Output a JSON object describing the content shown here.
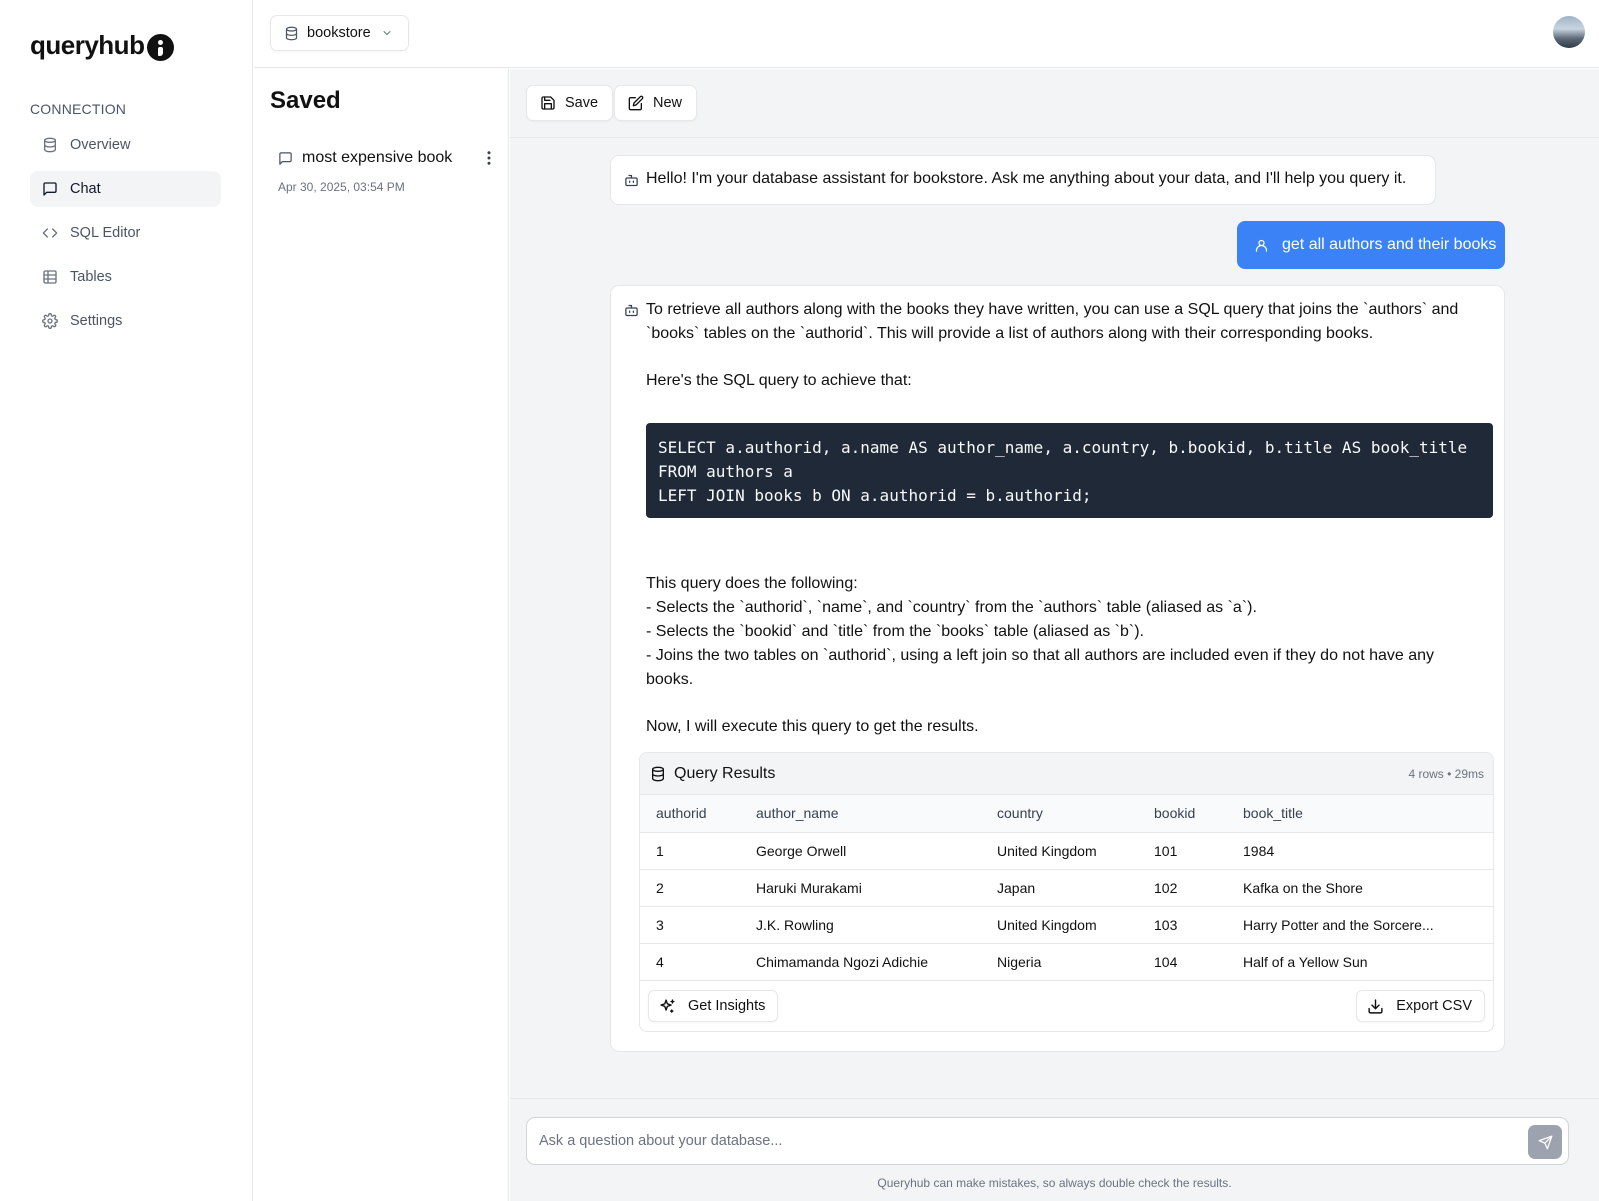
{
  "app": {
    "name": "queryhub"
  },
  "sidebar": {
    "section_label": "CONNECTION",
    "items": [
      {
        "label": "Overview",
        "icon": "database-icon",
        "active": false
      },
      {
        "label": "Chat",
        "icon": "message-square-icon",
        "active": true
      },
      {
        "label": "SQL Editor",
        "icon": "code-icon",
        "active": false
      },
      {
        "label": "Tables",
        "icon": "table-icon",
        "active": false
      },
      {
        "label": "Settings",
        "icon": "gear-icon",
        "active": false
      }
    ]
  },
  "topbar": {
    "database": "bookstore"
  },
  "saved": {
    "title": "Saved",
    "items": [
      {
        "name": "most expensive book",
        "date": "Apr 30, 2025, 03:54 PM"
      }
    ]
  },
  "toolbar": {
    "save_label": "Save",
    "new_label": "New"
  },
  "chat": {
    "greeting": "Hello! I'm your database assistant for bookstore. Ask me anything about your data, and I'll help you query it.",
    "user_message": "get all authors and their books",
    "reply_intro": "To retrieve all authors along with the books they have written, you can use a SQL query that joins the `authors` and `books` tables on the `authorid`. This will provide a list of authors along with their corresponding books.",
    "reply_lead": "Here's the SQL query to achieve that:",
    "sql": "SELECT a.authorid, a.name AS author_name, a.country, b.bookid, b.title AS book_title\nFROM authors a\nLEFT JOIN books b ON a.authorid = b.authorid;",
    "explain_title": "This query does the following:",
    "explain_1": "- Selects the `authorid`, `name`, and `country` from the `authors` table (aliased as `a`).",
    "explain_2": "- Selects the `bookid` and `title` from the `books` table (aliased as `b`).",
    "explain_3": "- Joins the two tables on `authorid`, using a left join so that all authors are included even if they do not have any books.",
    "closing": "Now, I will execute this query to get the results."
  },
  "results": {
    "title": "Query Results",
    "meta": "4 rows • 29ms",
    "columns": [
      "authorid",
      "author_name",
      "country",
      "bookid",
      "book_title"
    ],
    "rows": [
      [
        "1",
        "George Orwell",
        "United Kingdom",
        "101",
        "1984"
      ],
      [
        "2",
        "Haruki Murakami",
        "Japan",
        "102",
        "Kafka on the Shore"
      ],
      [
        "3",
        "J.K. Rowling",
        "United Kingdom",
        "103",
        "Harry Potter and the Sorcere..."
      ],
      [
        "4",
        "Chimamanda Ngozi Adichie",
        "Nigeria",
        "104",
        "Half of a Yellow Sun"
      ]
    ],
    "insights_label": "Get Insights",
    "export_label": "Export CSV"
  },
  "composer": {
    "placeholder": "Ask a question about your database...",
    "disclaimer": "Queryhub can make mistakes, so always double check the results."
  },
  "colors": {
    "accent": "#3b82f6",
    "code_bg": "#1f2937",
    "panel_bg": "#f3f4f6"
  }
}
